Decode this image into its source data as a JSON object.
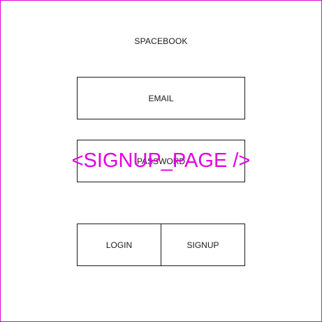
{
  "app": {
    "title": "SPACEBOOK"
  },
  "form": {
    "email_label": "EMAIL",
    "password_label": "PASSWORD",
    "login_label": "LOGIN",
    "signup_label": "SIGNUP"
  },
  "overlay": {
    "label": "<SIGNUP_PAGE />"
  },
  "colors": {
    "frame_border": "#e000e0",
    "overlay_text": "#e000e0",
    "box_border": "#1a1a1a"
  }
}
